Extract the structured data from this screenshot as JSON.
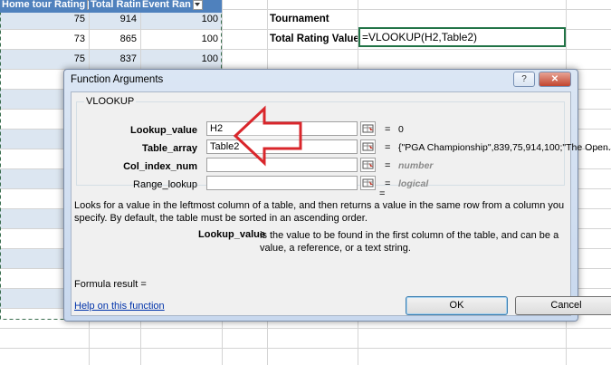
{
  "sheet": {
    "headers": [
      "Home tour Rating",
      "Total Rating",
      "Event Ran"
    ],
    "rows": [
      [
        "75",
        "914",
        "100"
      ],
      [
        "73",
        "865",
        "100"
      ],
      [
        "75",
        "837",
        "100"
      ]
    ],
    "labels": {
      "tournament": "Tournament",
      "total_rating_value": "Total Rating Value"
    },
    "formula": "=VLOOKUP(H2,Table2)"
  },
  "dialog": {
    "title": "Function Arguments",
    "help_glyph": "?",
    "close_glyph": "✕",
    "function_name": "VLOOKUP",
    "args": [
      {
        "name": "Lookup_value",
        "value": "H2",
        "result": "0",
        "bold": true
      },
      {
        "name": "Table_array",
        "value": "Table2",
        "result": "{\"PGA Championship\",839,75,914,100;\"The Open...",
        "bold": true
      },
      {
        "name": "Col_index_num",
        "value": "",
        "result": "number",
        "bold": true
      },
      {
        "name": "Range_lookup",
        "value": "",
        "result": "logical",
        "bold": false
      }
    ],
    "equals": "=",
    "description": "Looks for a value in the leftmost column of a table, and then returns a value in the same row from a column you specify. By default, the table must be sorted in an ascending order.",
    "arg_help_name": "Lookup_value",
    "arg_help_text": "is the value to be found in the first column of the table, and can be a value, a reference, or a text string.",
    "formula_result_label": "Formula result =",
    "help_link": "Help on this function",
    "ok": "OK",
    "cancel": "Cancel"
  },
  "colors": {
    "header_blue": "#4f81bd",
    "band_blue": "#dce6f1",
    "active_cell": "#217346",
    "arrow_red": "#d9262b"
  }
}
